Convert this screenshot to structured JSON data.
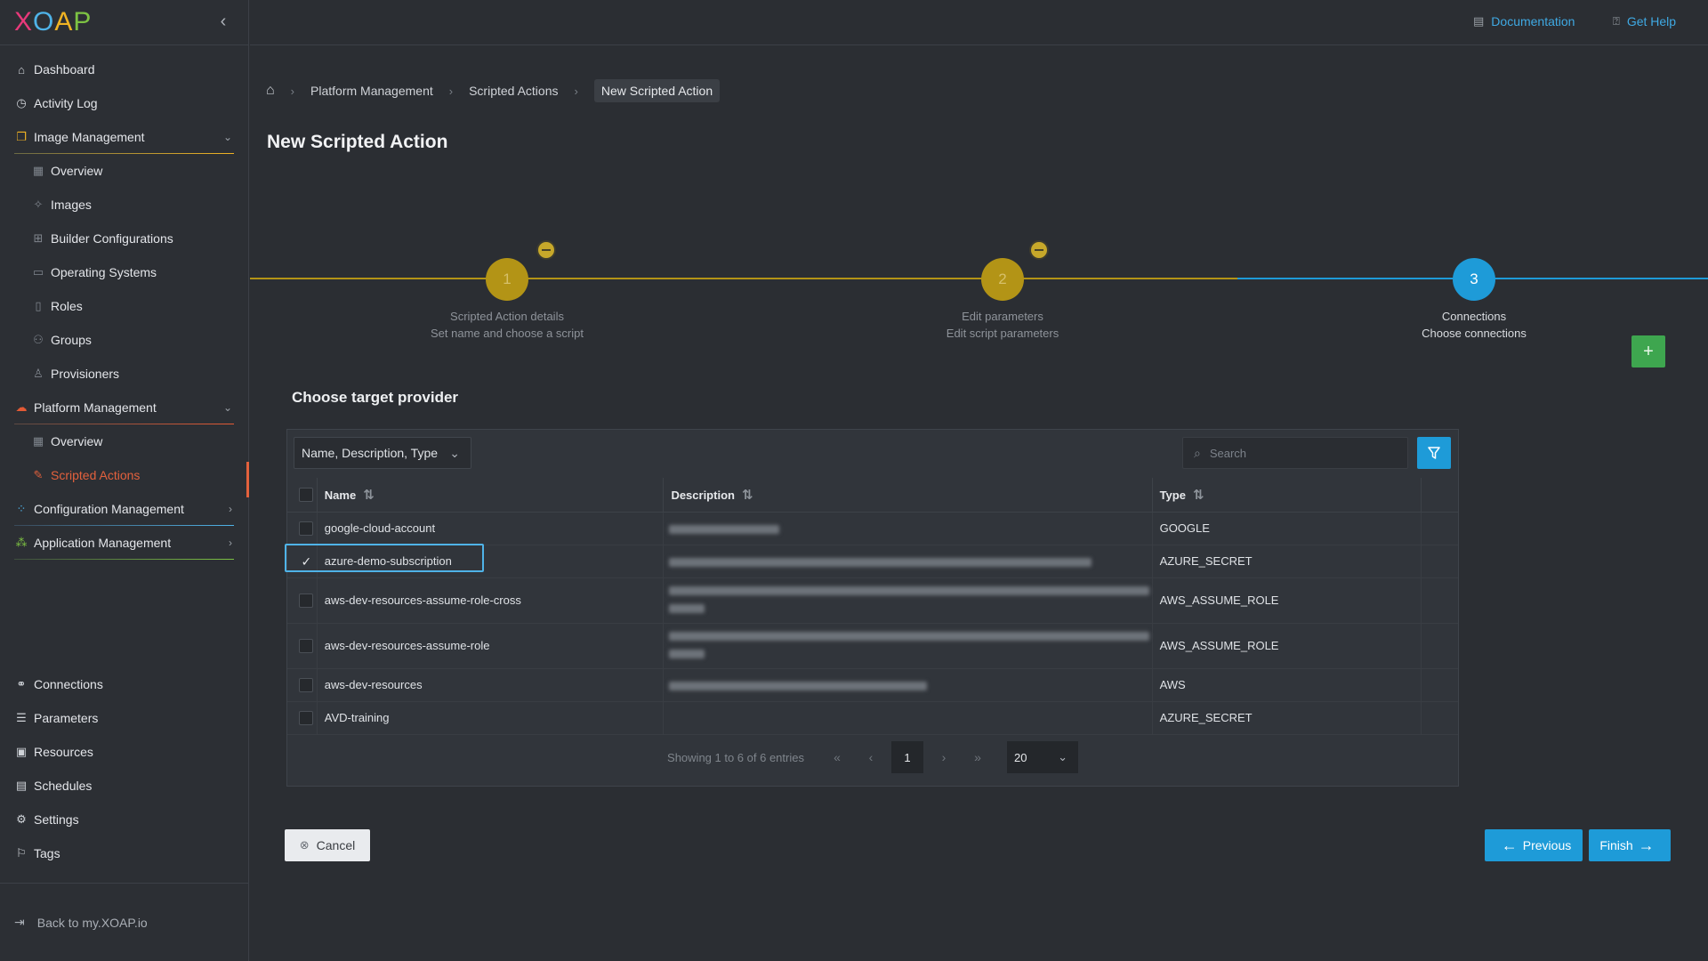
{
  "logo": [
    "X",
    "O",
    "A",
    "P"
  ],
  "colors": {
    "accent": "#1e9bd8",
    "active": "#e3613d",
    "step_done": "#b39416",
    "add": "#3ea64f"
  },
  "sidebar": {
    "items": [
      {
        "label": "Dashboard",
        "icon": "home-icon"
      },
      {
        "label": "Activity Log",
        "icon": "clock-icon"
      },
      {
        "label": "Image Management",
        "icon": "images-icon",
        "expanded": true
      },
      {
        "label": "Overview",
        "icon": "table-icon"
      },
      {
        "label": "Images",
        "icon": "diamond-icon"
      },
      {
        "label": "Builder Configurations",
        "icon": "grid-icon"
      },
      {
        "label": "Operating Systems",
        "icon": "monitor-icon"
      },
      {
        "label": "Roles",
        "icon": "book-icon"
      },
      {
        "label": "Groups",
        "icon": "group-icon"
      },
      {
        "label": "Provisioners",
        "icon": "person-icon"
      },
      {
        "label": "Platform Management",
        "icon": "cloud-icon",
        "expanded": true
      },
      {
        "label": "Overview",
        "icon": "table-icon"
      },
      {
        "label": "Scripted Actions",
        "icon": "pencil-icon",
        "active": true
      },
      {
        "label": "Configuration Management",
        "icon": "config-icon"
      },
      {
        "label": "Application Management",
        "icon": "apps-icon"
      }
    ],
    "bottom_items": [
      {
        "label": "Connections",
        "icon": "link-icon"
      },
      {
        "label": "Parameters",
        "icon": "list-icon"
      },
      {
        "label": "Resources",
        "icon": "box-icon"
      },
      {
        "label": "Schedules",
        "icon": "calendar-icon"
      },
      {
        "label": "Settings",
        "icon": "gear-icon"
      },
      {
        "label": "Tags",
        "icon": "bookmark-icon"
      }
    ],
    "back_label": "Back to my.XOAP.io"
  },
  "header": {
    "documentation": "Documentation",
    "help": "Get Help"
  },
  "breadcrumb": {
    "items": [
      "Platform Management",
      "Scripted Actions"
    ],
    "current": "New Scripted Action"
  },
  "page_title": "New Scripted Action",
  "stepper": {
    "steps": [
      {
        "number": "1",
        "title": "Scripted Action details",
        "subtitle": "Set name and choose a script",
        "state": "done"
      },
      {
        "number": "2",
        "title": "Edit parameters",
        "subtitle": "Edit script parameters",
        "state": "done"
      },
      {
        "number": "3",
        "title": "Connections",
        "subtitle": "Choose connections",
        "state": "current"
      }
    ]
  },
  "add_label": "+",
  "section_title": "Choose target provider",
  "filter": {
    "selected": "Name, Description, Type"
  },
  "search": {
    "placeholder": "Search",
    "value": ""
  },
  "table": {
    "columns": [
      "Name",
      "Description",
      "Type"
    ],
    "rows": [
      {
        "name": "google-cloud-account",
        "type": "GOOGLE",
        "checked": false
      },
      {
        "name": "azure-demo-subscription",
        "type": "AZURE_SECRET",
        "checked": true
      },
      {
        "name": "aws-dev-resources-assume-role-cross",
        "type": "AWS_ASSUME_ROLE",
        "checked": false
      },
      {
        "name": "aws-dev-resources-assume-role",
        "type": "AWS_ASSUME_ROLE",
        "checked": false
      },
      {
        "name": "aws-dev-resources",
        "type": "AWS",
        "checked": false
      },
      {
        "name": "AVD-training",
        "type": "AZURE_SECRET",
        "checked": false
      }
    ]
  },
  "pager": {
    "info": "Showing 1 to 6 of 6 entries",
    "page": "1",
    "page_size": "20"
  },
  "buttons": {
    "cancel": "Cancel",
    "previous": "Previous",
    "finish": "Finish"
  }
}
